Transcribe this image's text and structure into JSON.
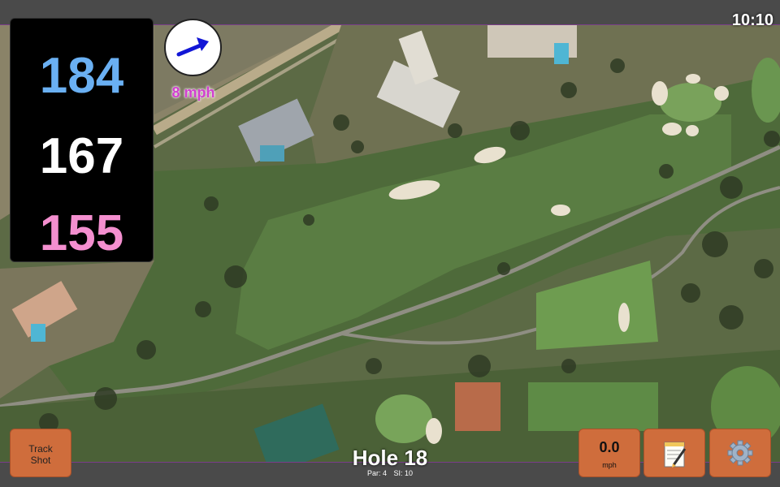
{
  "status": {
    "time": "10:10"
  },
  "distances": {
    "back": "184",
    "middle": "167",
    "front": "155"
  },
  "wind": {
    "speed_label": "8 mph",
    "icon": "wind-direction-arrow-icon"
  },
  "hole": {
    "title": "Hole 18",
    "par": "Par: 4",
    "stroke_index": "SI: 10"
  },
  "buttons": {
    "track_shot_line1": "Track",
    "track_shot_line2": "Shot",
    "speed_value": "0.0",
    "speed_unit": "mph",
    "notes_icon": "notes-icon",
    "settings_icon": "gear-icon"
  },
  "colors": {
    "back_distance": "#6ab0f3",
    "middle_distance": "#ffffff",
    "front_distance": "#f48fcf",
    "wind_label": "#d23fcf",
    "button": "#cf6d3c"
  }
}
